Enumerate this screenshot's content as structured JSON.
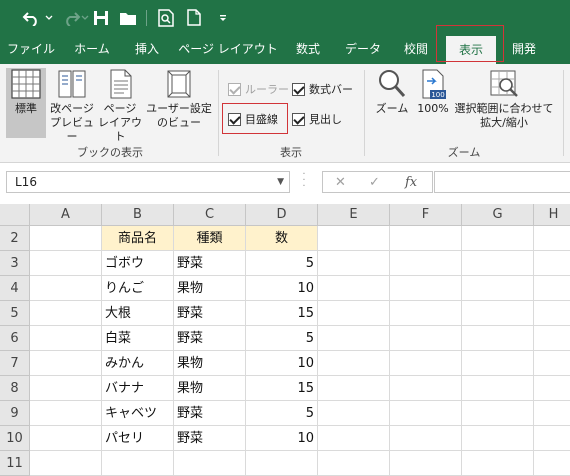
{
  "quick_access": {
    "icons": [
      "undo-icon",
      "redo-icon",
      "save-icon",
      "open-icon",
      "print-preview-icon",
      "new-file-icon",
      "customize-qat-icon"
    ]
  },
  "tabs": [
    {
      "label": "ファイル",
      "active": false
    },
    {
      "label": "ホーム",
      "active": false
    },
    {
      "label": "挿入",
      "active": false
    },
    {
      "label": "ページ レイアウト",
      "active": false
    },
    {
      "label": "数式",
      "active": false
    },
    {
      "label": "データ",
      "active": false
    },
    {
      "label": "校閲",
      "active": false
    },
    {
      "label": "表示",
      "active": true
    },
    {
      "label": "開発",
      "active": false
    }
  ],
  "ribbon": {
    "workbook_views": {
      "group_label": "ブックの表示",
      "normal": "標準",
      "page_break_line1": "改ページ",
      "page_break_line2": "プレビュー",
      "page_layout_line1": "ページ",
      "page_layout_line2": "レイアウト",
      "custom_views_line1": "ユーザー設定",
      "custom_views_line2": "のビュー"
    },
    "show": {
      "group_label": "表示",
      "ruler": {
        "label": "ルーラー",
        "checked": true,
        "enabled": false
      },
      "formula_bar": {
        "label": "数式バー",
        "checked": true,
        "enabled": true
      },
      "gridlines": {
        "label": "目盛線",
        "checked": true,
        "enabled": true
      },
      "headings": {
        "label": "見出し",
        "checked": true,
        "enabled": true
      }
    },
    "zoom": {
      "group_label": "ズーム",
      "zoom": "ズーム",
      "zoom_100": "100%",
      "zoom_to_selection_line1": "選択範囲に合わせて",
      "zoom_to_selection_line2": "拡大/縮小"
    }
  },
  "formula_bar": {
    "name_box": "L16",
    "formula": ""
  },
  "grid": {
    "columns": [
      "A",
      "B",
      "C",
      "D",
      "E",
      "F",
      "G",
      "H"
    ],
    "rows": [
      "2",
      "3",
      "4",
      "5",
      "6",
      "7",
      "8",
      "9",
      "10",
      "11"
    ],
    "header_row": [
      "商品名",
      "種類",
      "数"
    ],
    "data": [
      [
        "ゴボウ",
        "野菜",
        "5"
      ],
      [
        "りんご",
        "果物",
        "10"
      ],
      [
        "大根",
        "野菜",
        "15"
      ],
      [
        "白菜",
        "野菜",
        "5"
      ],
      [
        "みかん",
        "果物",
        "10"
      ],
      [
        "バナナ",
        "果物",
        "15"
      ],
      [
        "キャベツ",
        "野菜",
        "5"
      ],
      [
        "パセリ",
        "野菜",
        "10"
      ]
    ]
  },
  "colors": {
    "excel_green": "#217346",
    "header_fill": "#fff2cc",
    "highlight_red": "#d13438"
  }
}
